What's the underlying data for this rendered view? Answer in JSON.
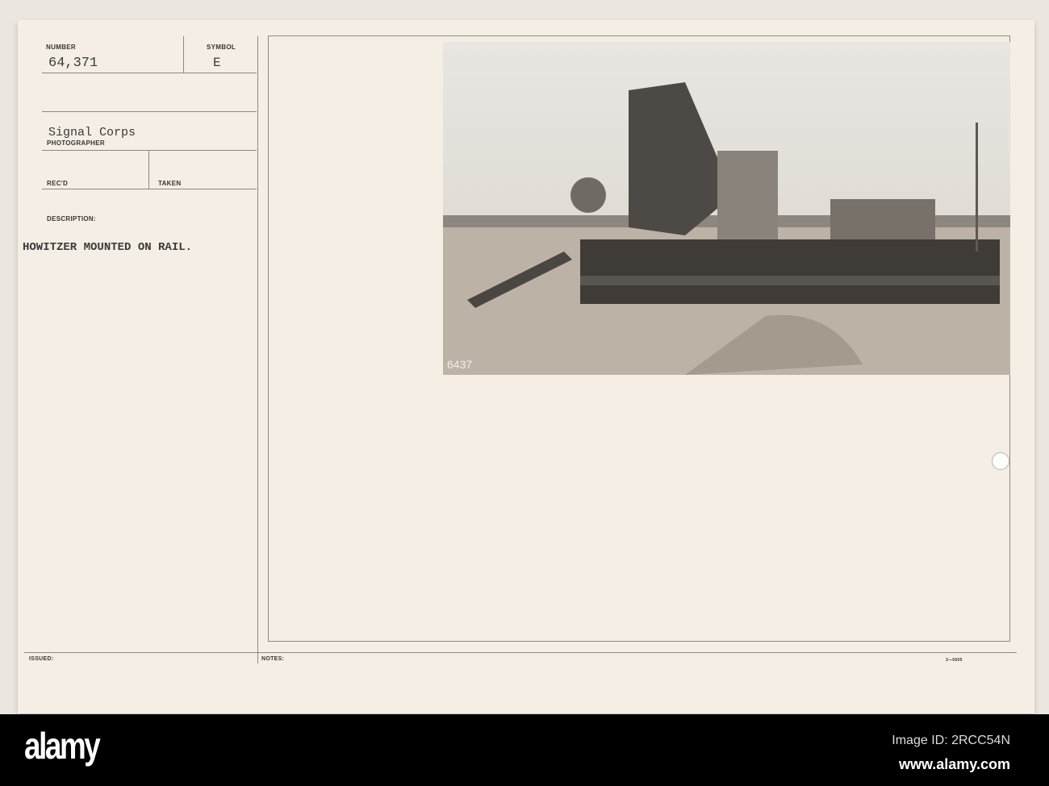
{
  "card": {
    "number_label": "NUMBER",
    "number_value": "64,371",
    "symbol_label": "SYMBOL",
    "symbol_value": "E",
    "photographer_value": "Signal Corps",
    "photographer_label": "PHOTOGRAPHER",
    "recd_label": "REC'D",
    "taken_label": "TAKEN",
    "description_label": "DESCRIPTION:",
    "description_value": "HOWITZER MOUNTED ON RAIL.",
    "issued_label": "ISSUED:",
    "notes_label": "NOTES:",
    "form_number": "3—5605"
  },
  "photo": {
    "caption_number": "6437"
  },
  "footer": {
    "logo": "alamy",
    "image_id": "Image ID: 2RCC54N",
    "website": "www.alamy.com"
  }
}
